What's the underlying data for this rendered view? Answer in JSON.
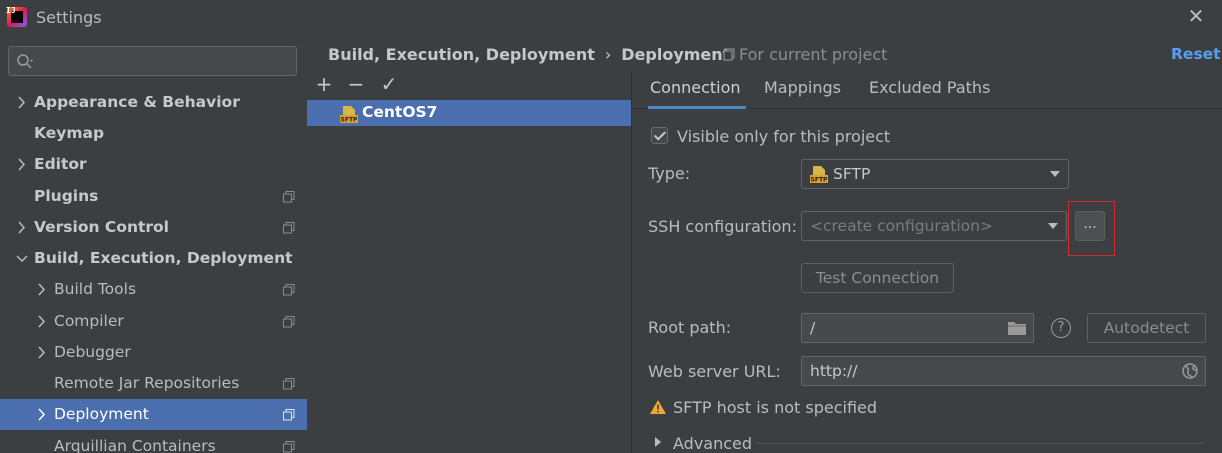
{
  "window": {
    "title": "Settings",
    "logo_text": "IJ"
  },
  "sidebar": {
    "search_placeholder": "",
    "items": [
      {
        "label": "Appearance & Behavior",
        "bold": true,
        "arrow": "right",
        "copy": false
      },
      {
        "label": "Keymap",
        "bold": true,
        "arrow": "",
        "copy": false
      },
      {
        "label": "Editor",
        "bold": true,
        "arrow": "right",
        "copy": false
      },
      {
        "label": "Plugins",
        "bold": true,
        "arrow": "",
        "copy": true
      },
      {
        "label": "Version Control",
        "bold": true,
        "arrow": "right",
        "copy": true
      },
      {
        "label": "Build, Execution, Deployment",
        "bold": true,
        "arrow": "down",
        "copy": false
      },
      {
        "label": "Build Tools",
        "bold": false,
        "arrow": "right",
        "copy": true
      },
      {
        "label": "Compiler",
        "bold": false,
        "arrow": "right",
        "copy": true
      },
      {
        "label": "Debugger",
        "bold": false,
        "arrow": "right",
        "copy": false
      },
      {
        "label": "Remote Jar Repositories",
        "bold": false,
        "arrow": "",
        "copy": true
      },
      {
        "label": "Deployment",
        "bold": false,
        "arrow": "right",
        "copy": true,
        "selected": true
      },
      {
        "label": "Arquillian Containers",
        "bold": false,
        "arrow": "",
        "copy": true
      }
    ]
  },
  "header": {
    "breadcrumb_parent": "Build, Execution, Deployment",
    "breadcrumb_separator": "›",
    "breadcrumb_current": "Deployment",
    "scope": "For current project",
    "reset": "Reset"
  },
  "server_list": {
    "toolbar": {
      "add": "+",
      "remove": "−",
      "apply": "✓"
    },
    "servers": [
      {
        "name": "CentOS7",
        "icon": "sftp-icon"
      }
    ]
  },
  "tabs": [
    {
      "label": "Connection",
      "active": true
    },
    {
      "label": "Mappings",
      "active": false
    },
    {
      "label": "Excluded Paths",
      "active": false
    }
  ],
  "connection": {
    "visible_only_label": "Visible only for this project",
    "visible_only_checked": true,
    "type_label": "Type:",
    "type_value": "SFTP",
    "ssh_label": "SSH configuration:",
    "ssh_placeholder": "<create configuration>",
    "ssh_more": "...",
    "test_connection": "Test Connection",
    "root_path_label": "Root path:",
    "root_path_value": "/",
    "autodetect": "Autodetect",
    "help_glyph": "?",
    "web_url_label": "Web server URL:",
    "web_url_value": "http://",
    "warning_text": "SFTP host is not specified",
    "advanced_label": "Advanced"
  },
  "colors": {
    "background": "#3c3f41",
    "selection": "#4b6eaf",
    "link": "#589df6",
    "highlight_border": "#d12d2d",
    "warning": "#f0a732"
  }
}
